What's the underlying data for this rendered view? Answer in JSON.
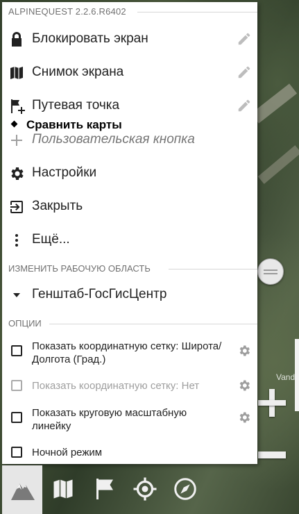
{
  "app": {
    "version": "ALPINEQUEST 2.2.6.R6402"
  },
  "menu": {
    "items": [
      {
        "label": "Блокировать экран",
        "icon": "lock-icon",
        "editable": true
      },
      {
        "label": "Снимок экрана",
        "icon": "map-icon",
        "editable": true
      },
      {
        "label": "Путевая точка",
        "icon": "flag-plus-icon",
        "editable": true
      },
      {
        "label": "Пользовательская кнопка",
        "icon": "plus-icon",
        "editable": false
      },
      {
        "label": "Настройки",
        "icon": "gear-icon",
        "editable": false
      },
      {
        "label": "Закрыть",
        "icon": "exit-icon",
        "editable": false
      },
      {
        "label": "Ещё...",
        "icon": "more-vertical-icon",
        "editable": false
      }
    ],
    "overlay_label": "Сравнить карты",
    "workspace_header": "ИЗМЕНИТЬ РАБОЧУЮ ОБЛАСТЬ",
    "workspace_name": "Генштаб-ГосГисЦентр",
    "options_header": "ОПЦИИ",
    "options": [
      {
        "label": "Показать координатную сетку: Широта/Долгота (Град.)",
        "checked": false,
        "enabled": true,
        "settings": true
      },
      {
        "label": "Показать координатную сетку: Нет",
        "checked": false,
        "enabled": false,
        "settings": true
      },
      {
        "label": "Показать круговую масштабную линейку",
        "checked": false,
        "enabled": true,
        "settings": true
      },
      {
        "label": "Ночной режим",
        "checked": false,
        "enabled": true,
        "settings": false
      }
    ]
  },
  "map": {
    "visible_label": "Vand"
  },
  "toolbar": {
    "buttons": [
      "mountain-icon",
      "map-icon",
      "flag-icon",
      "location-target-icon",
      "compass-icon"
    ],
    "active": "mountain-icon"
  },
  "colors": {
    "menu_bg": "#ffffff",
    "text": "#212121",
    "secondary": "#707070",
    "disabled": "#9e9e9e"
  }
}
